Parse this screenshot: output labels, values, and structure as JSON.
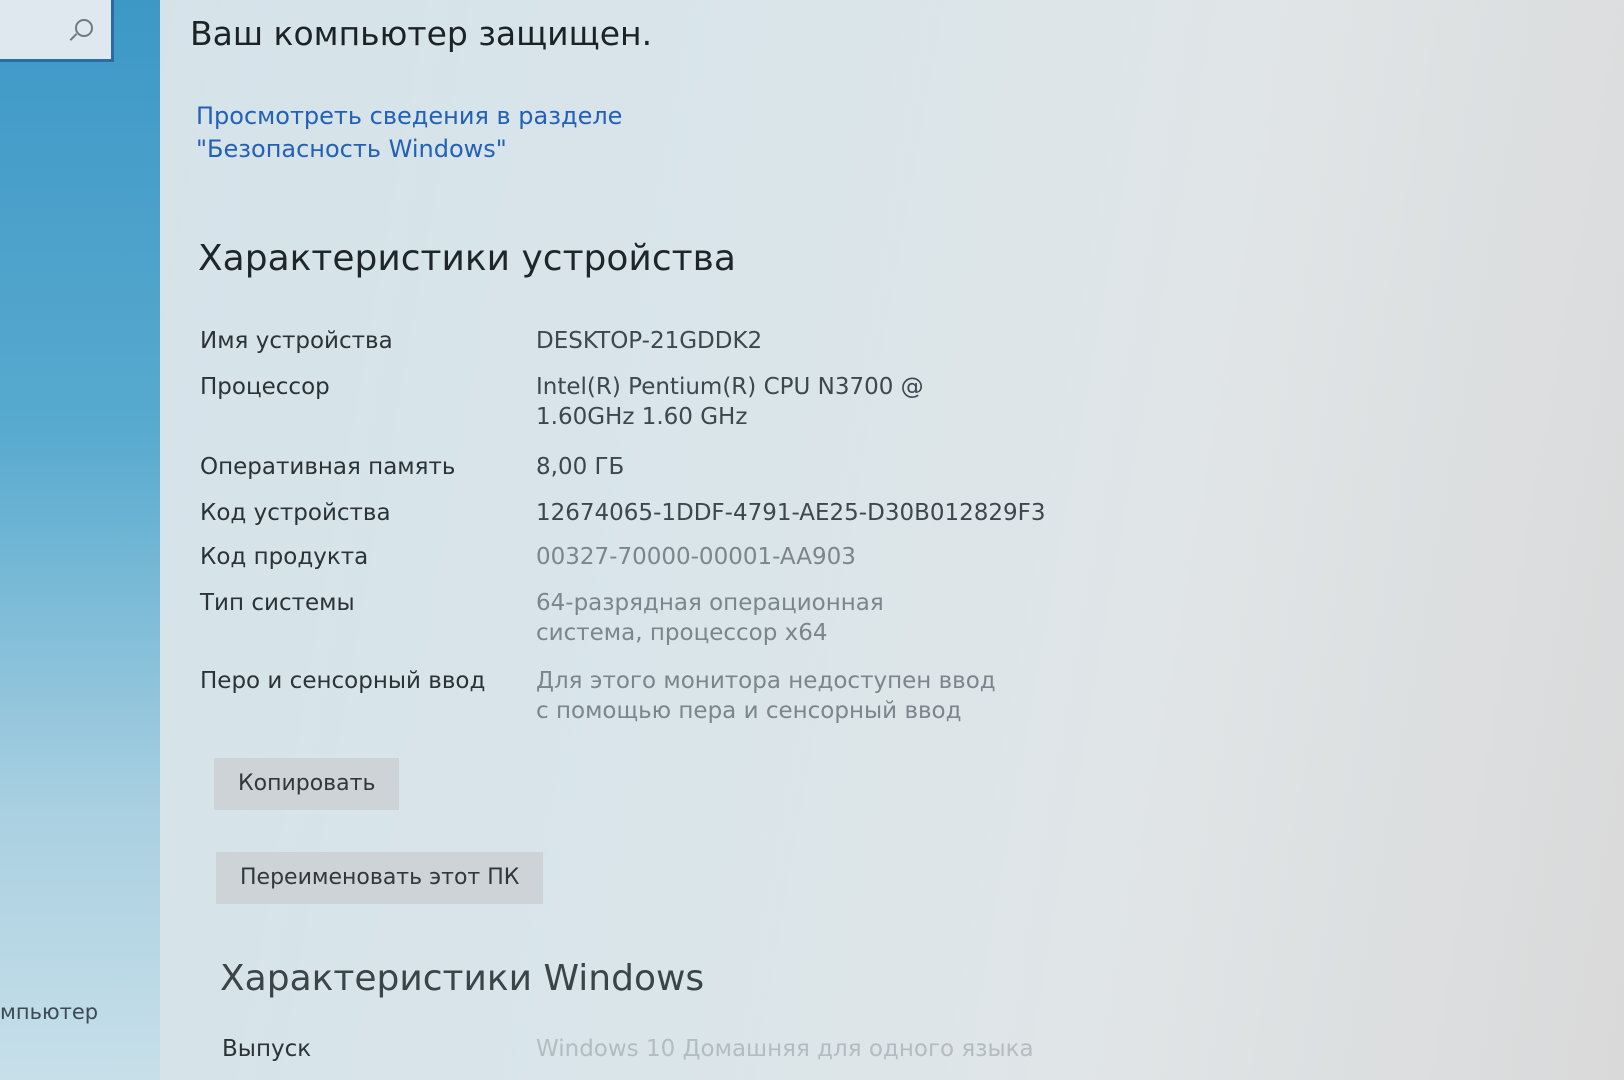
{
  "sidebar": {
    "search": {
      "icon": "search-icon"
    },
    "bottom_item_label": "мпьютер"
  },
  "main": {
    "protected_title": "Ваш компьютер защищен.",
    "security_link": "Просмотреть сведения в разделе \"Безопасность Windows\"",
    "device_spec": {
      "title": "Характеристики устройства",
      "rows": [
        {
          "label": "Имя устройства",
          "value": "DESKTOP-21GDDK2"
        },
        {
          "label": "Процессор",
          "value": "Intel(R) Pentium(R) CPU  N3700  @ 1.60GHz 1.60 GHz"
        },
        {
          "label": "Оперативная память",
          "value": "8,00 ГБ"
        },
        {
          "label": "Код устройства",
          "value": "12674065-1DDF-4791-AE25-D30B012829F3"
        },
        {
          "label": "Код продукта",
          "value": "00327-70000-00001-AA903"
        },
        {
          "label": "Тип системы",
          "value": "64-разрядная операционная система, процессор x64"
        },
        {
          "label": "Перо и сенсорный ввод",
          "value": "Для этого монитора недоступен ввод с помощью пера и сенсорный ввод"
        }
      ],
      "copy_button": "Копировать",
      "rename_button": "Переименовать этот ПК"
    },
    "windows_spec": {
      "title": "Характеристики Windows",
      "edition_label": "Выпуск",
      "edition_value": "Windows 10 Домашняя для одного языка"
    }
  }
}
